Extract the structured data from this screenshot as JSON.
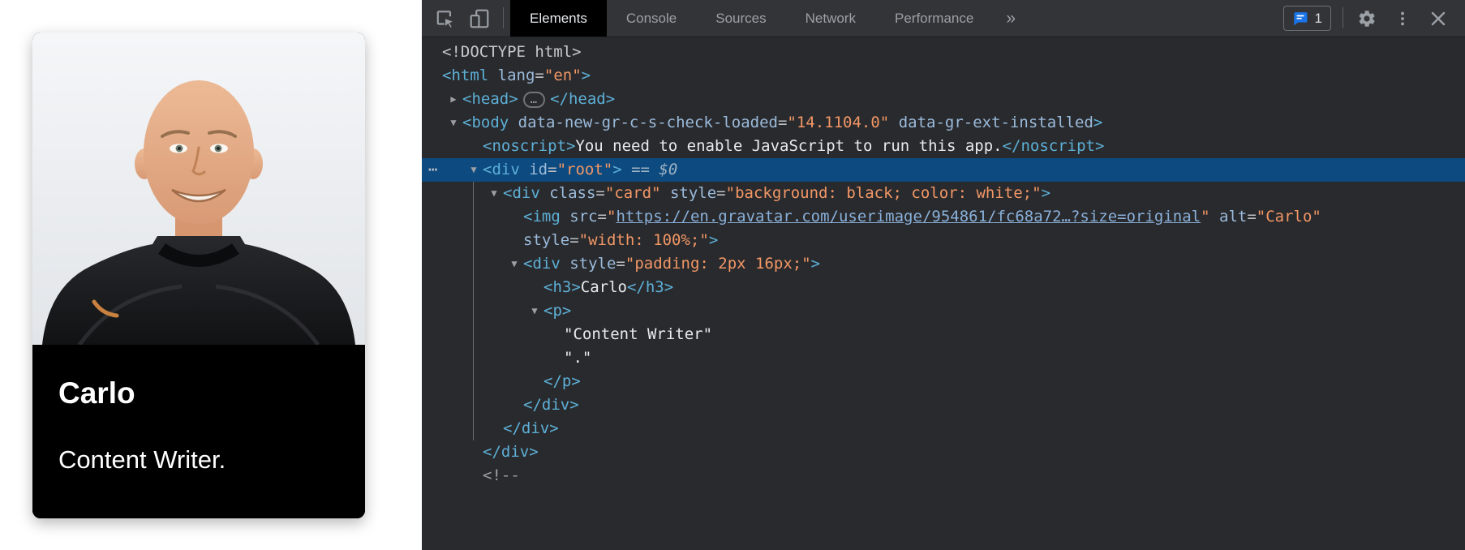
{
  "profile": {
    "name": "Carlo",
    "role": "Content Writer."
  },
  "devtools": {
    "tabs": [
      {
        "label": "Elements",
        "active": true
      },
      {
        "label": "Console",
        "active": false
      },
      {
        "label": "Sources",
        "active": false
      },
      {
        "label": "Network",
        "active": false
      },
      {
        "label": "Performance",
        "active": false
      }
    ],
    "more_tabs_symbol": "»",
    "issues_count": "1",
    "colors": {
      "toolbar_bg": "#333438",
      "panel_bg": "#292a2d",
      "tab_active_bg": "#000000",
      "selection_bg": "#0d4a80",
      "tag": "#5db0d7",
      "attr_name": "#9bbbdc",
      "attr_value": "#f29766",
      "link": "#8ab0d9",
      "plain_text": "#e8eaed",
      "issues_icon_blue": "#1a73e8"
    }
  },
  "code": {
    "icons": {
      "expanded": "▼",
      "collapsed": "▶",
      "gutter_dots": "⋯"
    },
    "lines": [
      {
        "indent": 25,
        "segs": [
          {
            "t": "<!DOCTYPE html>",
            "c": "doctype"
          }
        ]
      },
      {
        "indent": 25,
        "segs": [
          {
            "t": "<html",
            "c": "tag"
          },
          {
            "t": " "
          },
          {
            "t": "lang",
            "c": "attr"
          },
          {
            "t": "=",
            "c": "eq"
          },
          {
            "t": "\"en\"",
            "c": "val"
          },
          {
            "t": ">",
            "c": "tag"
          }
        ]
      },
      {
        "indent": 50,
        "arrow": "collapsed",
        "segs": [
          {
            "t": "<head>",
            "c": "tag"
          },
          {
            "t": "…",
            "c": "pill"
          },
          {
            "t": "</head>",
            "c": "tag"
          }
        ]
      },
      {
        "indent": 50,
        "arrow": "expanded",
        "segs": [
          {
            "t": "<body",
            "c": "tag"
          },
          {
            "t": " "
          },
          {
            "t": "data-new-gr-c-s-check-loaded",
            "c": "attr"
          },
          {
            "t": "=",
            "c": "eq"
          },
          {
            "t": "\"14.1104.0\"",
            "c": "val"
          },
          {
            "t": " "
          },
          {
            "t": "data-gr-ext-installed",
            "c": "attr"
          },
          {
            "t": ">",
            "c": "tag"
          }
        ]
      },
      {
        "indent": 75,
        "segs": [
          {
            "t": "<noscript>",
            "c": "tag"
          },
          {
            "t": "You need to enable JavaScript to run this app.",
            "c": "text"
          },
          {
            "t": "</noscript>",
            "c": "tag"
          }
        ]
      },
      {
        "indent": 75,
        "selected": true,
        "dots": true,
        "arrow": "expanded",
        "segs": [
          {
            "t": "<div",
            "c": "tag"
          },
          {
            "t": " "
          },
          {
            "t": "id",
            "c": "attr"
          },
          {
            "t": "=",
            "c": "eq"
          },
          {
            "t": "\"root\"",
            "c": "val"
          },
          {
            "t": ">",
            "c": "tag"
          },
          {
            "t": " == $0",
            "c": "flag"
          }
        ]
      },
      {
        "indent": 100,
        "arrow": "expanded",
        "segs": [
          {
            "t": "<div",
            "c": "tag"
          },
          {
            "t": " "
          },
          {
            "t": "class",
            "c": "attr"
          },
          {
            "t": "=",
            "c": "eq"
          },
          {
            "t": "\"card\"",
            "c": "val"
          },
          {
            "t": " "
          },
          {
            "t": "style",
            "c": "attr"
          },
          {
            "t": "=",
            "c": "eq"
          },
          {
            "t": "\"background: black; color: white;\"",
            "c": "val"
          },
          {
            "t": ">",
            "c": "tag"
          }
        ]
      },
      {
        "indent": 125,
        "segs": [
          {
            "t": "<img",
            "c": "tag"
          },
          {
            "t": " "
          },
          {
            "t": "src",
            "c": "attr"
          },
          {
            "t": "=",
            "c": "eq"
          },
          {
            "t": "\"",
            "c": "val"
          },
          {
            "t": "https://en.gravatar.com/userimage/954861/fc68a72…?size=original",
            "c": "link"
          },
          {
            "t": "\"",
            "c": "val"
          },
          {
            "t": " "
          },
          {
            "t": "alt",
            "c": "attr"
          },
          {
            "t": "=",
            "c": "eq"
          },
          {
            "t": "\"Carlo\"",
            "c": "val"
          }
        ]
      },
      {
        "indent": 125,
        "segs": [
          {
            "t": "style",
            "c": "attr"
          },
          {
            "t": "=",
            "c": "eq"
          },
          {
            "t": "\"width: 100%;\"",
            "c": "val"
          },
          {
            "t": ">",
            "c": "tag"
          }
        ]
      },
      {
        "indent": 125,
        "arrow": "expanded",
        "segs": [
          {
            "t": "<div",
            "c": "tag"
          },
          {
            "t": " "
          },
          {
            "t": "style",
            "c": "attr"
          },
          {
            "t": "=",
            "c": "eq"
          },
          {
            "t": "\"padding: 2px 16px;\"",
            "c": "val"
          },
          {
            "t": ">",
            "c": "tag"
          }
        ]
      },
      {
        "indent": 150,
        "segs": [
          {
            "t": "<h3>",
            "c": "tag"
          },
          {
            "t": "Carlo",
            "c": "text"
          },
          {
            "t": "</h3>",
            "c": "tag"
          }
        ]
      },
      {
        "indent": 150,
        "arrow": "expanded",
        "segs": [
          {
            "t": "<p>",
            "c": "tag"
          }
        ]
      },
      {
        "indent": 175,
        "segs": [
          {
            "t": "\"Content Writer\"",
            "c": "text"
          }
        ]
      },
      {
        "indent": 175,
        "segs": [
          {
            "t": "\".\"",
            "c": "text"
          }
        ]
      },
      {
        "indent": 150,
        "segs": [
          {
            "t": "</p>",
            "c": "tag"
          }
        ]
      },
      {
        "indent": 125,
        "segs": [
          {
            "t": "</div>",
            "c": "tag"
          }
        ]
      },
      {
        "indent": 100,
        "segs": [
          {
            "t": "</div>",
            "c": "tag"
          }
        ]
      },
      {
        "indent": 75,
        "segs": [
          {
            "t": "</div>",
            "c": "tag"
          }
        ]
      },
      {
        "indent": 75,
        "segs": [
          {
            "t": "<!--",
            "c": "comment"
          }
        ]
      }
    ]
  }
}
